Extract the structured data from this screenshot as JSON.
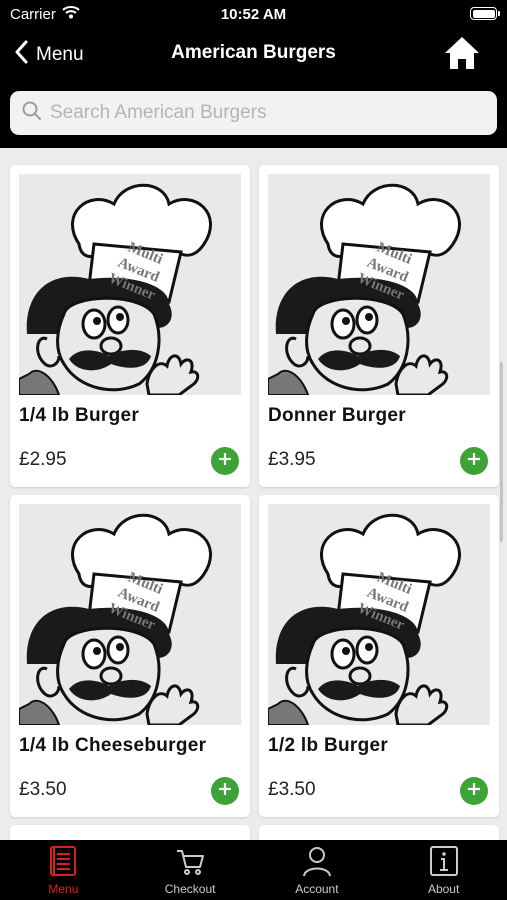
{
  "status": {
    "carrier": "Carrier",
    "time": "10:52 AM"
  },
  "nav": {
    "back_label": "Menu",
    "title": "American Burgers"
  },
  "search": {
    "placeholder": "Search American Burgers"
  },
  "mascot": {
    "hat_text": [
      "Multi",
      "Award",
      "Winner"
    ]
  },
  "products": [
    {
      "name": "1/4 lb Burger",
      "price": "£2.95"
    },
    {
      "name": "Donner Burger",
      "price": "£3.95"
    },
    {
      "name": "1/4 lb Cheeseburger",
      "price": "£3.50"
    },
    {
      "name": "1/2 lb Burger",
      "price": "£3.50"
    }
  ],
  "tabs": [
    {
      "label": "Menu",
      "icon": "menu-book-icon",
      "active": true
    },
    {
      "label": "Checkout",
      "icon": "cart-icon",
      "active": false
    },
    {
      "label": "Account",
      "icon": "user-icon",
      "active": false
    },
    {
      "label": "About",
      "icon": "info-icon",
      "active": false
    }
  ],
  "colors": {
    "accent": "#d4231b",
    "add_button": "#3da336",
    "header_bg": "#000000"
  }
}
